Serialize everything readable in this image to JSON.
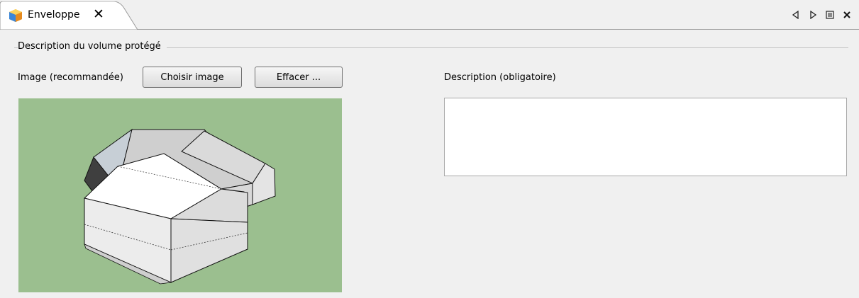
{
  "tab": {
    "title": "Enveloppe",
    "close_glyph": "✕",
    "icon": "box-cube-icon"
  },
  "view_controls": {
    "prev_icon": "triangle-left-icon",
    "next_icon": "triangle-right-icon",
    "list_icon": "list-icon",
    "close_icon": "close-icon"
  },
  "group": {
    "title": "Description du volume protégé"
  },
  "image_section": {
    "label": "Image (recommandée)",
    "choose_button": "Choisir image",
    "clear_button": "Effacer ...",
    "image_background": "#9bbf8f"
  },
  "description_section": {
    "label": "Description (obligatoire)",
    "value": ""
  },
  "colors": {
    "window_bg": "#f0f0f0",
    "field_bg": "#ffffff",
    "border": "#a8a8a8"
  }
}
